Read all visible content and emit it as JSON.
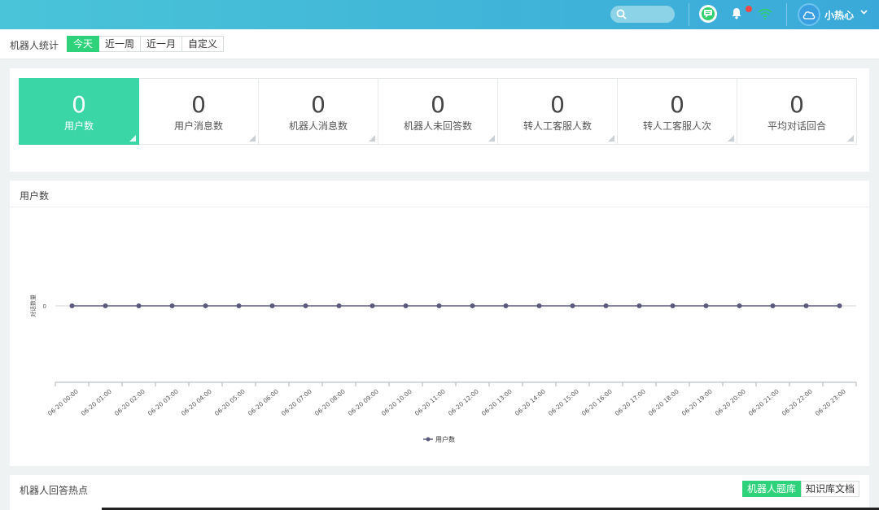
{
  "header": {
    "username": "小热心",
    "accent_color": "#3aa9d9",
    "icons": [
      "search-icon",
      "chat-icon",
      "bell-icon",
      "wifi-icon",
      "cloud-avatar-icon",
      "chevron-down-icon"
    ]
  },
  "period": {
    "title": "机器人统计",
    "tabs": [
      "今天",
      "近一周",
      "近一月",
      "自定义"
    ],
    "active": "今天"
  },
  "stats": [
    {
      "value": "0",
      "label": "用户数"
    },
    {
      "value": "0",
      "label": "用户消息数"
    },
    {
      "value": "0",
      "label": "机器人消息数"
    },
    {
      "value": "0",
      "label": "机器人未回答数"
    },
    {
      "value": "0",
      "label": "转人工客服人数"
    },
    {
      "value": "0",
      "label": "转人工客服人次"
    },
    {
      "value": "0",
      "label": "平均对话回合"
    }
  ],
  "chart_panel": {
    "title": "用户数"
  },
  "chart_data": {
    "type": "line",
    "ylabel": "对话数量",
    "x": [
      "06-20 00:00",
      "06-20 01:00",
      "06-20 02:00",
      "06-20 03:00",
      "06-20 04:00",
      "06-20 05:00",
      "06-20 06:00",
      "06-20 07:00",
      "06-20 08:00",
      "06-20 09:00",
      "06-20 10:00",
      "06-20 11:00",
      "06-20 12:00",
      "06-20 13:00",
      "06-20 14:00",
      "06-20 15:00",
      "06-20 16:00",
      "06-20 17:00",
      "06-20 18:00",
      "06-20 19:00",
      "06-20 20:00",
      "06-20 21:00",
      "06-20 22:00",
      "06-20 23:00"
    ],
    "series": [
      {
        "name": "用户数",
        "values": [
          0,
          0,
          0,
          0,
          0,
          0,
          0,
          0,
          0,
          0,
          0,
          0,
          0,
          0,
          0,
          0,
          0,
          0,
          0,
          0,
          0,
          0,
          0,
          0
        ],
        "color": "#5b5a7e"
      }
    ],
    "y_ticks": [
      "0"
    ],
    "legend": "bottom-center"
  },
  "hot_panel": {
    "title": "机器人回答热点",
    "tabs": [
      "机器人题库",
      "知识库文档"
    ],
    "active": "机器人题库"
  },
  "colors": {
    "green": "#2ed27b",
    "card_active": "#3bd6a6"
  }
}
